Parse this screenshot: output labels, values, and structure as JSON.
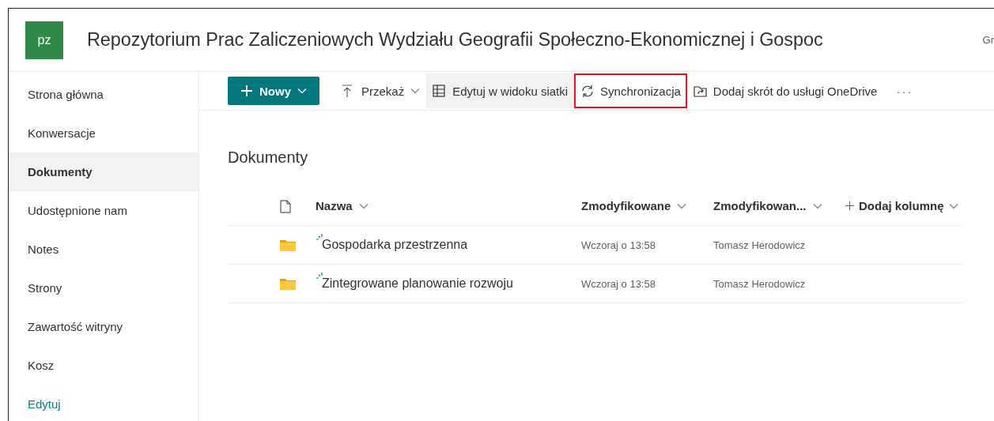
{
  "site": {
    "logo": "pz",
    "title": "Repozytorium Prac Zaliczeniowych Wydziału Geografii Społeczno-Ekonomicznej i Gospoc",
    "right_text": "Gr"
  },
  "sidebar": {
    "items": [
      {
        "label": "Strona główna",
        "selected": false,
        "kind": "nav"
      },
      {
        "label": "Konwersacje",
        "selected": false,
        "kind": "nav"
      },
      {
        "label": "Dokumenty",
        "selected": true,
        "kind": "nav"
      },
      {
        "label": "Udostępnione nam",
        "selected": false,
        "kind": "nav"
      },
      {
        "label": "Notes",
        "selected": false,
        "kind": "nav"
      },
      {
        "label": "Strony",
        "selected": false,
        "kind": "nav"
      },
      {
        "label": "Zawartość witryny",
        "selected": false,
        "kind": "nav"
      },
      {
        "label": "Kosz",
        "selected": false,
        "kind": "nav"
      },
      {
        "label": "Edytuj",
        "selected": false,
        "kind": "link"
      }
    ]
  },
  "toolbar": {
    "items": [
      {
        "kind": "primary",
        "label": "Nowy",
        "highlighted": false
      },
      {
        "kind": "upload",
        "label": "Przekaż",
        "highlighted": false
      },
      {
        "kind": "grid",
        "label": "Edytuj w widoku siatki",
        "highlighted": false
      },
      {
        "kind": "sync",
        "label": "Synchronizacja",
        "highlighted": true
      },
      {
        "kind": "shortcut",
        "label": "Dodaj skrót do usługi OneDrive",
        "highlighted": false
      },
      {
        "kind": "more",
        "label": "···",
        "highlighted": false
      }
    ]
  },
  "library": {
    "title": "Dokumenty",
    "columns": [
      {
        "label": "Nazwa",
        "kind": "sort"
      },
      {
        "label": "Zmodyfikowane",
        "kind": "sort"
      },
      {
        "label": "Zmodyfikowan...",
        "kind": "sort"
      },
      {
        "label": "Dodaj kolumnę",
        "kind": "add"
      }
    ],
    "rows": [
      {
        "name": "Gospodarka przestrzenna",
        "modified": "Wczoraj o 13:58",
        "modified_by": "Tomasz Herodowicz",
        "new": true
      },
      {
        "name": "Zintegrowane planowanie rozwoju",
        "modified": "Wczoraj o 13:58",
        "modified_by": "Tomasz Herodowicz",
        "new": true
      }
    ]
  }
}
